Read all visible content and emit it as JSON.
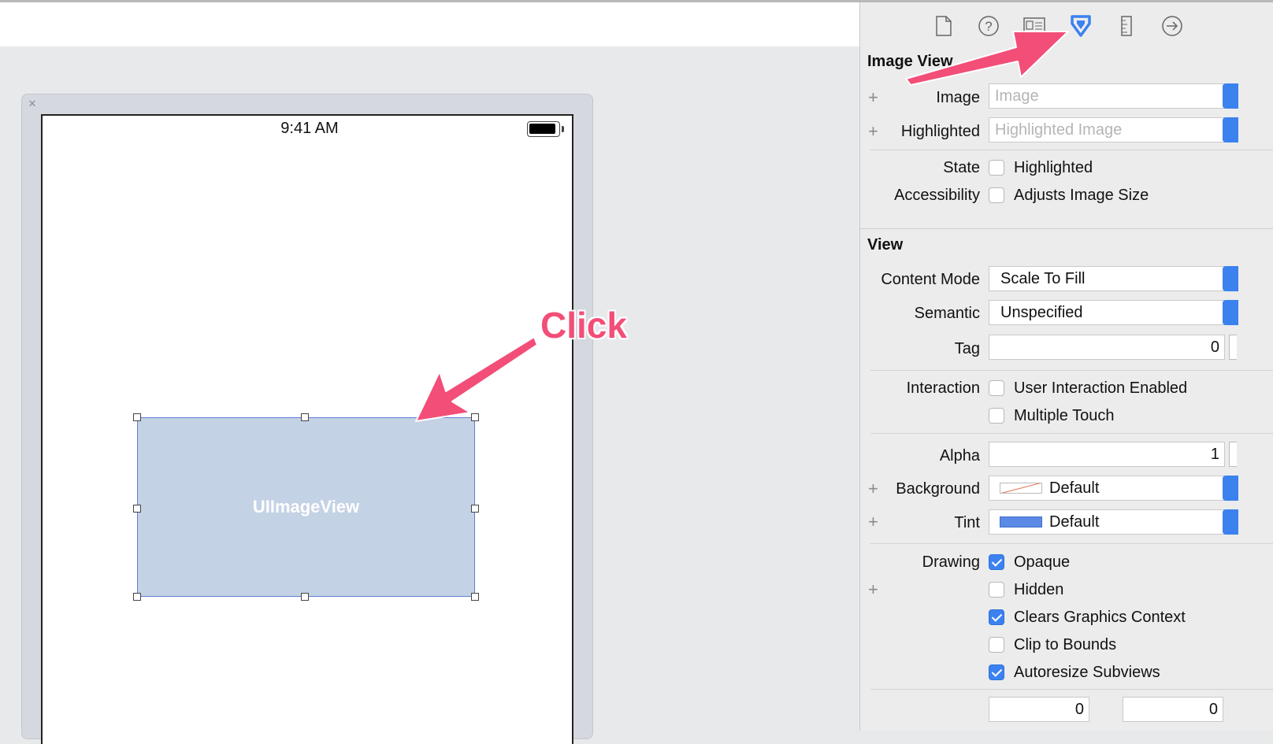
{
  "canvas": {
    "status_time": "9:41 AM",
    "image_view_label": "UIImageView",
    "annotation_text": "Click",
    "annotation_color": "#f24e78",
    "selection_color": "#5f7fd8"
  },
  "inspector": {
    "tabs": [
      {
        "name": "file-inspector",
        "icon": "document-icon"
      },
      {
        "name": "quick-help",
        "icon": "question-circle-icon"
      },
      {
        "name": "identity-inspector",
        "icon": "identity-card-icon"
      },
      {
        "name": "attributes-inspector",
        "icon": "attributes-shield-icon",
        "selected": true
      },
      {
        "name": "size-inspector",
        "icon": "ruler-icon"
      },
      {
        "name": "connections-inspector",
        "icon": "arrow-circle-icon"
      }
    ],
    "accent_color": "#3b82f0",
    "image_view": {
      "title": "Image View",
      "image_label": "Image",
      "image_placeholder": "Image",
      "highlighted_label": "Highlighted",
      "highlighted_placeholder": "Highlighted Image",
      "state_label": "State",
      "state_option": "Highlighted",
      "accessibility_label": "Accessibility",
      "accessibility_option": "Adjusts Image Size"
    },
    "view": {
      "title": "View",
      "content_mode_label": "Content Mode",
      "content_mode_value": "Scale To Fill",
      "semantic_label": "Semantic",
      "semantic_value": "Unspecified",
      "tag_label": "Tag",
      "tag_value": "0",
      "interaction_label": "Interaction",
      "user_interaction_label": "User Interaction Enabled",
      "multiple_touch_label": "Multiple Touch",
      "alpha_label": "Alpha",
      "alpha_value": "1",
      "background_label": "Background",
      "background_value": "Default",
      "tint_label": "Tint",
      "tint_value": "Default",
      "drawing_label": "Drawing",
      "opaque_label": "Opaque",
      "hidden_label": "Hidden",
      "clears_label": "Clears Graphics Context",
      "clip_label": "Clip to Bounds",
      "autoresize_label": "Autoresize Subviews",
      "stretching_value_1": "0",
      "stretching_value_2": "0"
    }
  }
}
